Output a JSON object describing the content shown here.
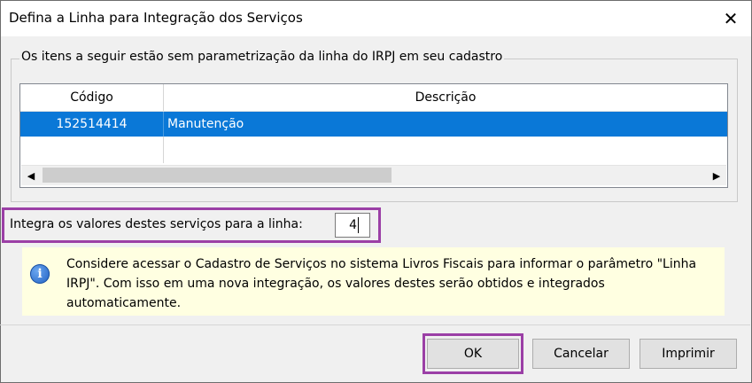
{
  "window": {
    "title": "Defina a Linha para Integração dos Serviços",
    "close_glyph": "✕"
  },
  "group": {
    "legend": "Os itens a seguir estão sem parametrização da linha do IRPJ em seu cadastro"
  },
  "grid": {
    "columns": [
      "Código",
      "Descrição"
    ],
    "rows": [
      {
        "codigo": "152514414",
        "descricao": "Manutenção",
        "selected": true
      }
    ],
    "scroll_left_glyph": "◀",
    "scroll_right_glyph": "▶"
  },
  "field": {
    "label": "Integra os valores destes serviços para a linha:",
    "value": "4"
  },
  "info": {
    "icon": "info-icon",
    "text": "Considere acessar o Cadastro de Serviços no sistema Livros Fiscais para informar o parâmetro \"Linha IRPJ\". Com isso em uma nova integração, os valores destes serão obtidos e integrados automaticamente."
  },
  "buttons": {
    "ok": "OK",
    "cancel": "Cancelar",
    "print": "Imprimir"
  },
  "colors": {
    "selection": "#0a78d7",
    "highlight": "#9b3fa6",
    "info_background": "#ffffe1"
  }
}
